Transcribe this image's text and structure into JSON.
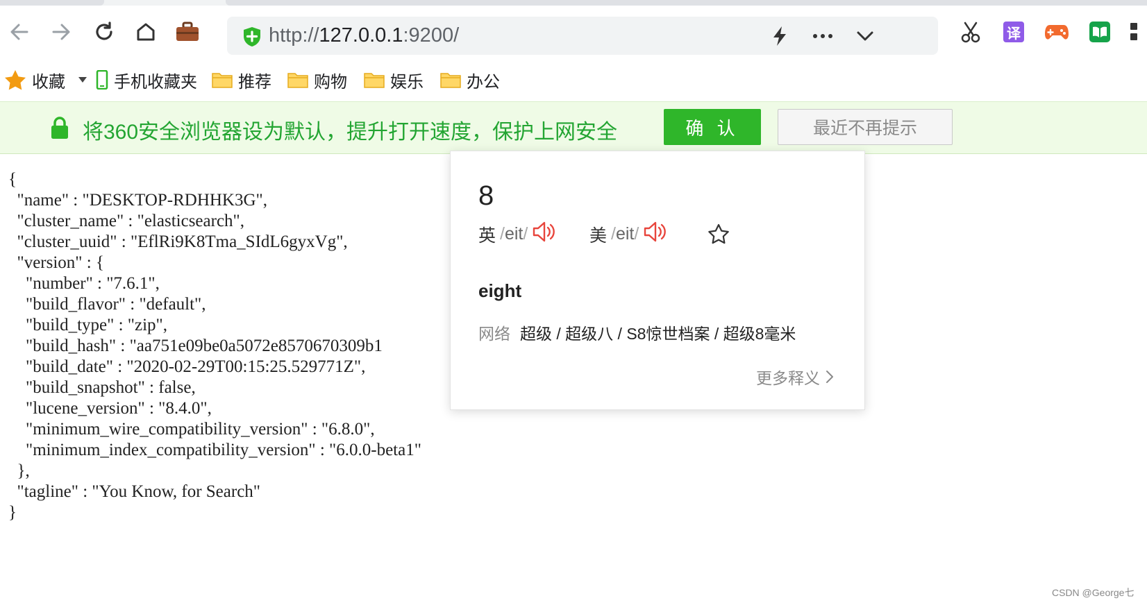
{
  "browser": {
    "address_bar": {
      "url_scheme": "http://",
      "url_host": "127.0.0.1",
      "url_rest": ":9200/"
    },
    "toolbar_icons": {
      "back": "arrow-left-icon",
      "forward": "arrow-right-icon",
      "reload": "reload-icon",
      "home": "home-icon",
      "briefcase": "briefcase-icon",
      "lightning": "lightning-icon",
      "more": "more-dots-icon",
      "dropdown": "chevron-down-icon",
      "screenshot": "scissors-icon",
      "translate_label": "译",
      "game": "gamepad-icon",
      "reader": "book-icon"
    },
    "colors": {
      "banner_bg": "#effbe6",
      "banner_text": "#23a532",
      "confirm_bg": "#2fb62a",
      "translate_bg": "#8f5be8",
      "game_color": "#f26a2e",
      "reader_bg": "#16a34a",
      "speaker_color": "#e8453c"
    }
  },
  "bookmarks": {
    "favorites_label": "收藏",
    "items": [
      {
        "label": "手机收藏夹",
        "icon": "phone-icon"
      },
      {
        "label": "推荐",
        "icon": "folder-icon"
      },
      {
        "label": "购物",
        "icon": "folder-icon"
      },
      {
        "label": "娱乐",
        "icon": "folder-icon"
      },
      {
        "label": "办公",
        "icon": "folder-icon"
      }
    ]
  },
  "banner": {
    "message": "将360安全浏览器设为默认，提升打开速度，保护上网安全",
    "confirm_label": "确 认",
    "dismiss_label": "最近不再提示"
  },
  "json_response": {
    "lines": [
      "{",
      "  \"name\" : \"DESKTOP-RDHHK3G\",",
      "  \"cluster_name\" : \"elasticsearch\",",
      "  \"cluster_uuid\" : \"EflRi9K8Tma_SIdL6gyxVg\",",
      "  \"version\" : {",
      "    \"number\" : \"7.6.1\",",
      "    \"build_flavor\" : \"default\",",
      "    \"build_type\" : \"zip\",",
      "    \"build_hash\" : \"aa751e09be0a5072e8570670309b1",
      "    \"build_date\" : \"2020-02-29T00:15:25.529771Z\",",
      "    \"build_snapshot\" : false,",
      "    \"lucene_version\" : \"8.4.0\",",
      "    \"minimum_wire_compatibility_version\" : \"6.8.0\",",
      "    \"minimum_index_compatibility_version\" : \"6.0.0-beta1\"",
      "  },",
      "  \"tagline\" : \"You Know, for Search\"",
      "}"
    ]
  },
  "dictionary_popup": {
    "word": "8",
    "uk_label": "英",
    "uk_ipa": "eit",
    "us_label": "美",
    "us_ipa": "eit",
    "slash": "/",
    "definition": "eight",
    "net_label": "网络",
    "net_value": "超级 / 超级八 / S8惊世档案 / 超级8毫米",
    "more_label": "更多释义"
  },
  "watermark": "CSDN @George七"
}
